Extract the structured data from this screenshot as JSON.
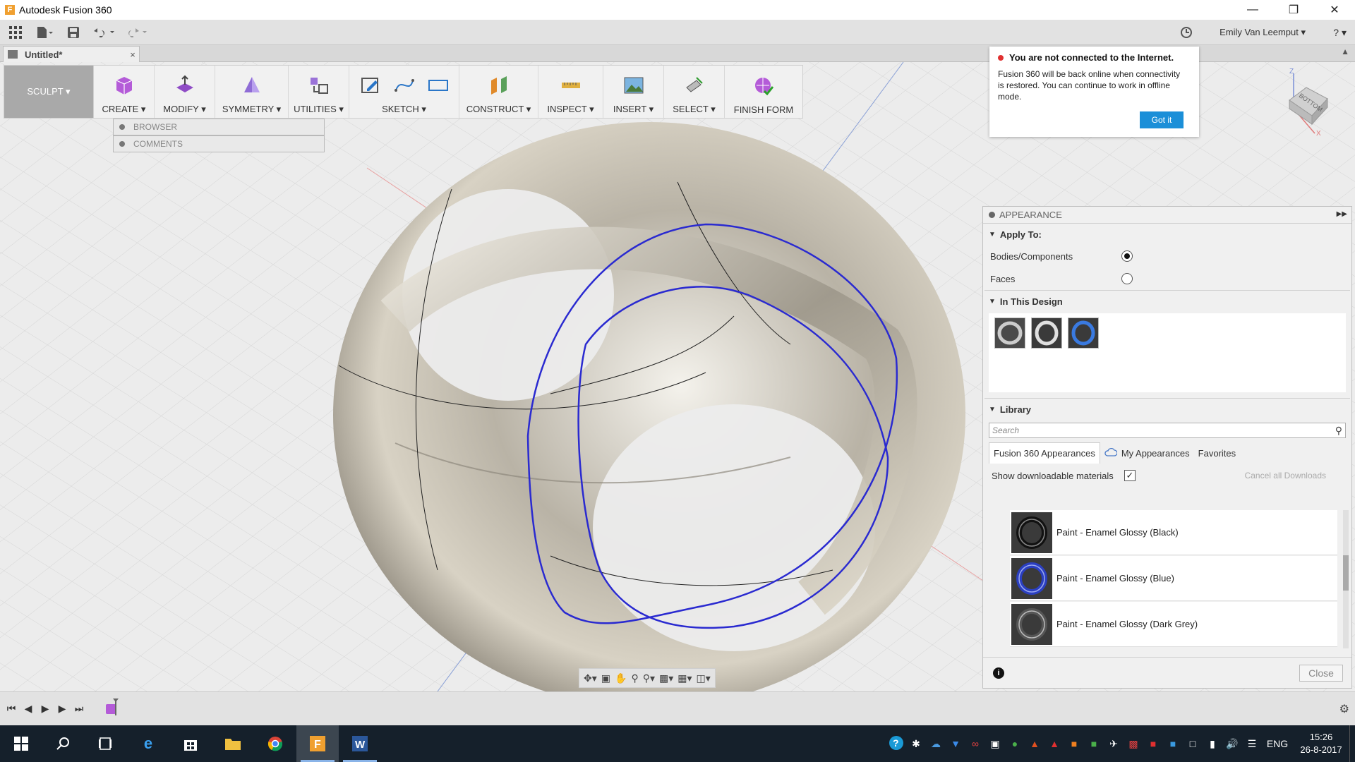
{
  "window": {
    "title": "Autodesk Fusion 360",
    "logo_letter": "F"
  },
  "quickbar": {
    "user_name": "Emily Van Leemput ▾",
    "help": "? ▾"
  },
  "document_tab": {
    "name": "Untitled*",
    "close": "×"
  },
  "toolbar": {
    "workspace": "SCULPT ▾",
    "groups": {
      "create": "CREATE ▾",
      "modify": "MODIFY ▾",
      "symmetry": "SYMMETRY ▾",
      "utilities": "UTILITIES ▾",
      "sketch": "SKETCH ▾",
      "construct": "CONSTRUCT ▾",
      "inspect": "INSPECT ▾",
      "insert": "INSERT ▾",
      "select": "SELECT ▾",
      "finish": "FINISH FORM"
    }
  },
  "panels": {
    "browser": "BROWSER",
    "comments": "COMMENTS"
  },
  "offline_notice": {
    "title": "You are not connected to the Internet.",
    "message": "Fusion 360 will be back online when connectivity is restored. You can continue to work in offline mode.",
    "button": "Got it"
  },
  "viewcube": {
    "face": "BOTTOM",
    "axis_z": "Z",
    "axis_x": "X"
  },
  "appearance": {
    "title": "APPEARANCE",
    "apply_to": {
      "heading": "Apply To:",
      "options": [
        "Bodies/Components",
        "Faces"
      ],
      "selected": "Bodies/Components"
    },
    "in_design": {
      "heading": "In This Design"
    },
    "library": {
      "heading": "Library",
      "search_placeholder": "Search",
      "tabs": [
        "Fusion 360 Appearances",
        "My Appearances",
        "Favorites"
      ],
      "show_downloadable": "Show downloadable materials",
      "show_downloadable_checked": true,
      "cancel_downloads": "Cancel all Downloads",
      "materials": [
        {
          "name": "Paint - Enamel Glossy (Black)",
          "color": "#2a2a2a"
        },
        {
          "name": "Paint - Enamel Glossy (Blue)",
          "color": "#2b3fc0"
        },
        {
          "name": "Paint - Enamel Glossy (Dark Grey)",
          "color": "#555555"
        }
      ]
    },
    "close": "Close",
    "info": "i"
  },
  "taskbar": {
    "language": "ENG",
    "time": "15:26",
    "date": "26-8-2017"
  }
}
